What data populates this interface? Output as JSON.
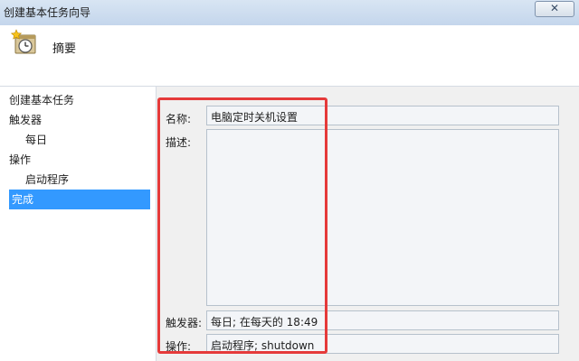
{
  "window": {
    "title": "创建基本任务向导",
    "close_label": "✕"
  },
  "header": {
    "title": "摘要",
    "icon": "scheduled-task-clock-icon"
  },
  "nav": {
    "items": [
      {
        "label": "创建基本任务"
      },
      {
        "label": "触发器"
      },
      {
        "label": "每日"
      },
      {
        "label": "操作"
      },
      {
        "label": "启动程序"
      },
      {
        "label": "完成"
      }
    ],
    "selected": "完成"
  },
  "summary": {
    "name_label": "名称:",
    "name_value": "电脑定时关机设置",
    "description_label": "描述:",
    "description_value": "",
    "trigger_label": "触发器:",
    "trigger_value": "每日; 在每天的 18:49",
    "action_label": "操作:",
    "action_value": "启动程序; shutdown"
  },
  "colors": {
    "highlight": "#e53a3a",
    "selection": "#3399ff"
  }
}
